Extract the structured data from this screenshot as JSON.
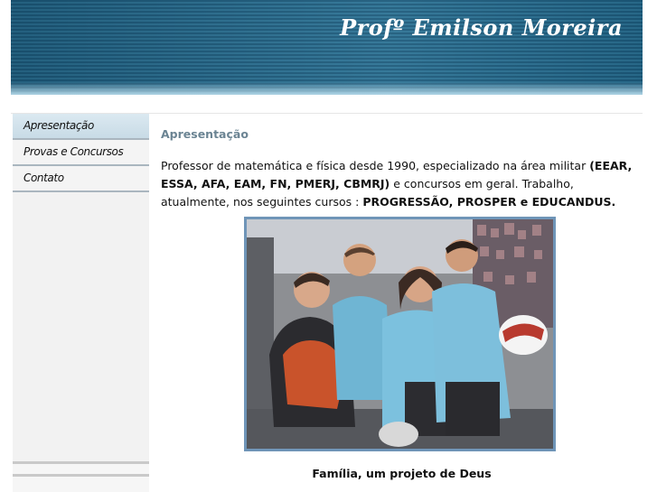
{
  "header": {
    "title": "Profº Emilson Moreira"
  },
  "nav": {
    "items": [
      {
        "label": "Apresentação"
      },
      {
        "label": "Provas e Concursos"
      },
      {
        "label": "Contato"
      }
    ]
  },
  "main": {
    "heading": "Apresentação",
    "intro_part1": "Professor de matemática e física desde 1990, especializado na área militar ",
    "intro_bold1": "(EEAR, ESSA, AFA, EAM, FN, PMERJ, CBMRJ)",
    "intro_part2": " e concursos em geral. Trabalho, atualmente, nos seguintes cursos : ",
    "intro_bold2": "PROGRESSÃO, PROSPER e EDUCANDUS.",
    "photo_caption": "Família, um projeto de Deus"
  },
  "colors": {
    "banner": "#2c7294",
    "heading": "#6b8493",
    "photo_border": "#6f95b8",
    "nav_active": "#c8dbe6"
  }
}
